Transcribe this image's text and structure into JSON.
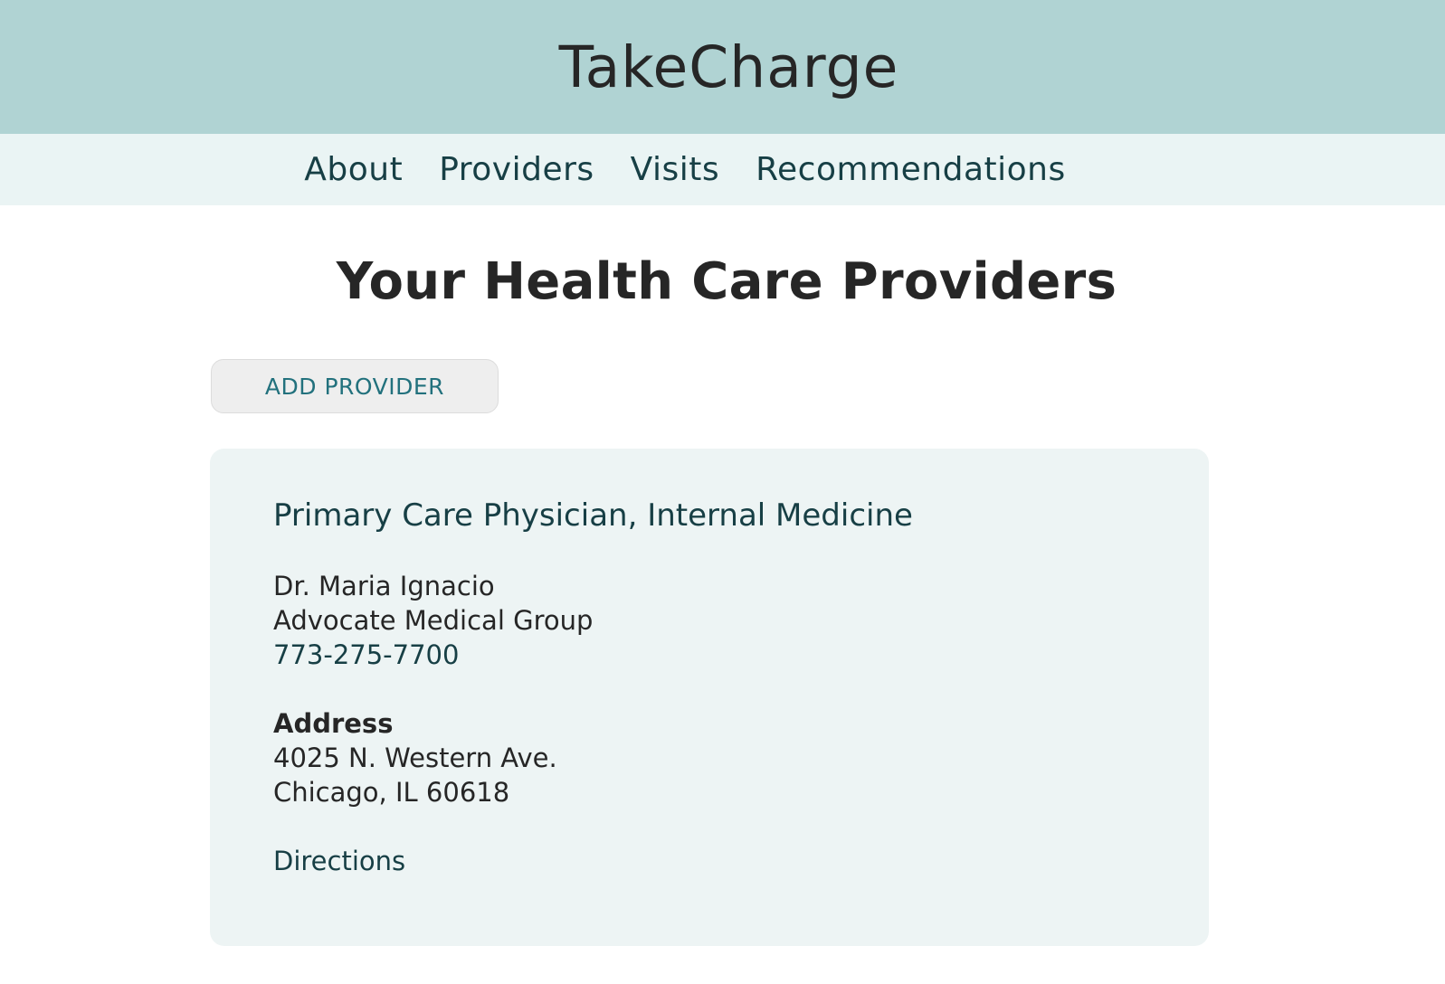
{
  "header": {
    "site_title": "TakeCharge"
  },
  "nav": {
    "items": [
      {
        "label": "About"
      },
      {
        "label": "Providers"
      },
      {
        "label": "Visits"
      },
      {
        "label": "Recommendations"
      }
    ]
  },
  "main": {
    "page_title": "Your Health Care Providers",
    "add_button_label": "ADD PROVIDER",
    "providers": [
      {
        "specialty": "Primary Care Physician, Internal Medicine",
        "name": "Dr. Maria Ignacio",
        "organization": "Advocate Medical Group",
        "phone": "773-275-7700",
        "address_label": "Address",
        "address_line1": "4025 N. Western Ave.",
        "address_line2": "Chicago, IL 60618",
        "directions_label": "Directions"
      }
    ]
  },
  "colors": {
    "header_bg": "#b0d3d3",
    "nav_bg": "#eaf4f4",
    "card_bg": "#edf4f4",
    "accent": "#173f45",
    "button_text": "#22717d"
  }
}
